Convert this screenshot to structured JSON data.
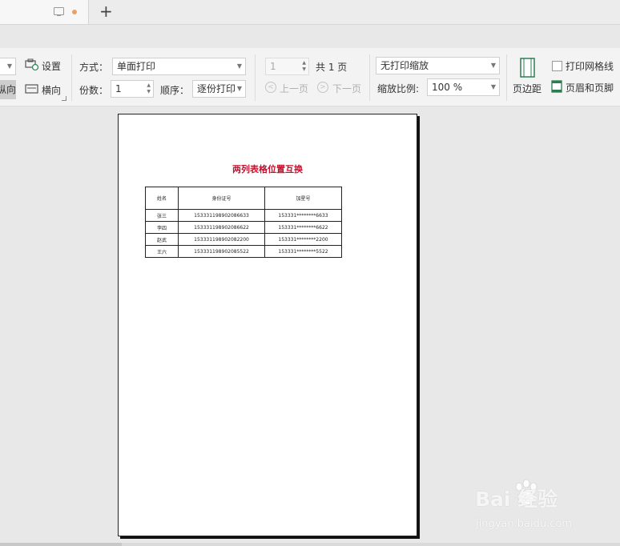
{
  "tabbar": {
    "new_tab": "+"
  },
  "ribbon": {
    "settings_label": "设置",
    "portrait_label": "纵向",
    "landscape_label": "横向",
    "mode_label": "方式：",
    "mode_value": "单面打印",
    "copies_label": "份数：",
    "copies_value": "1",
    "order_label": "顺序：",
    "order_value": "逐份打印",
    "page_value": "1",
    "total_pages": "共 1 页",
    "prev_page": "上一页",
    "next_page": "下一页",
    "scale_mode": "无打印缩放",
    "zoom_label": "缩放比例:",
    "zoom_value": "100 %",
    "margins_label": "页边距",
    "gridlines_label": "打印网格线",
    "header_footer_label": "页眉和页脚"
  },
  "document": {
    "title": "两列表格位置互换",
    "columns": [
      "姓名",
      "身份证号",
      "加星号"
    ],
    "rows": [
      [
        "张三",
        "153331198902086633",
        "153331********6633"
      ],
      [
        "李四",
        "153331198902086622",
        "153331********6622"
      ],
      [
        "赵武",
        "153331198902082200",
        "153331********2200"
      ],
      [
        "王六",
        "153331198902085522",
        "153331********5522"
      ]
    ]
  },
  "watermark": {
    "brand": "Bai  经验",
    "url": "jingyan.baidu.com"
  },
  "colors": {
    "title": "#c8102e",
    "tab_dot": "#e8a266"
  }
}
